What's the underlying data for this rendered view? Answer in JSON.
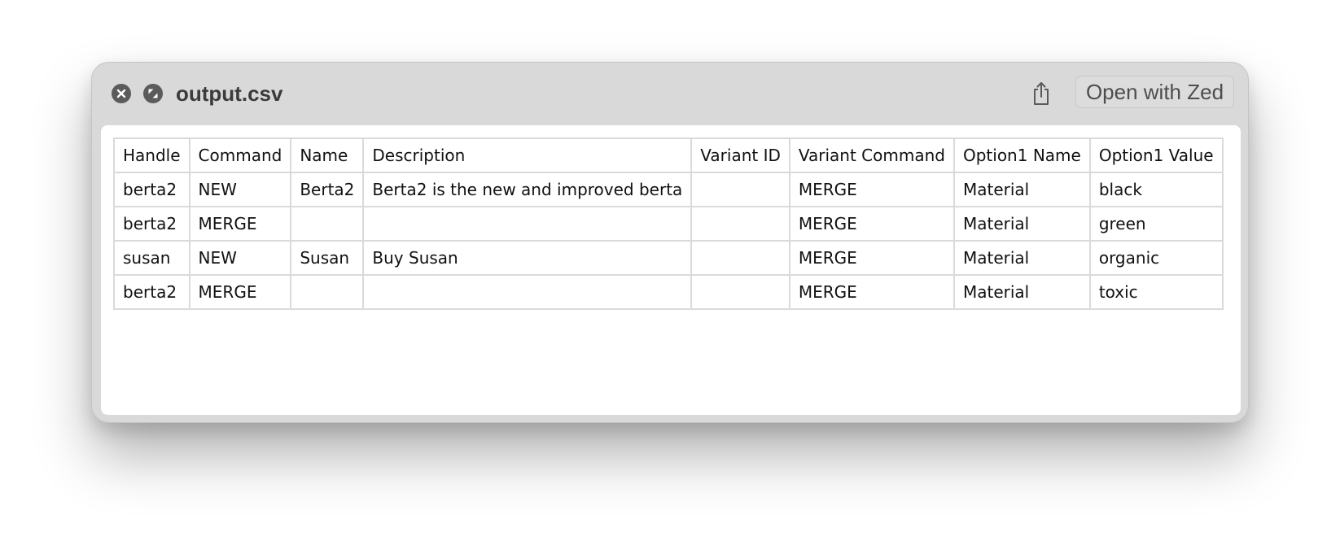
{
  "window": {
    "title": "output.csv",
    "open_with_label": "Open with Zed",
    "icons": {
      "close": "close-icon",
      "fullscreen": "fullscreen-icon",
      "share": "share-icon"
    }
  },
  "table": {
    "headers": [
      "Handle",
      "Command",
      "Name",
      "Description",
      "Variant ID",
      "Variant Command",
      "Option1 Name",
      "Option1 Value"
    ],
    "rows": [
      [
        "berta2",
        "NEW",
        "Berta2",
        "Berta2 is the new and improved berta",
        "",
        "MERGE",
        "Material",
        "black"
      ],
      [
        "berta2",
        "MERGE",
        "",
        "",
        "",
        "MERGE",
        "Material",
        "green"
      ],
      [
        "susan",
        "NEW",
        "Susan",
        "Buy Susan",
        "",
        "MERGE",
        "Material",
        "organic"
      ],
      [
        "berta2",
        "MERGE",
        "",
        "",
        "",
        "MERGE",
        "Material",
        "toxic"
      ]
    ]
  }
}
